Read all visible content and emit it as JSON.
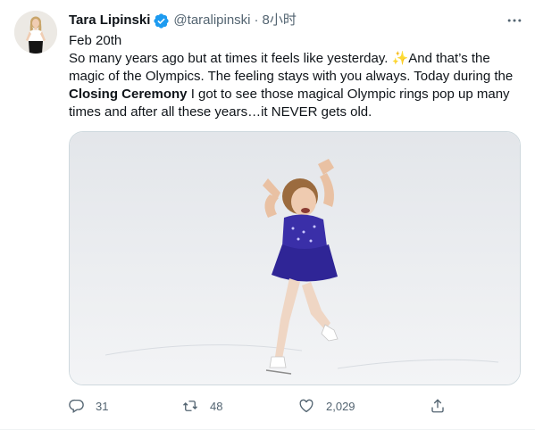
{
  "tweet": {
    "author": {
      "display_name": "Tara Lipinski",
      "handle": "@taralipinski",
      "verified_icon": "verified-badge-icon",
      "separator": "·",
      "time": "8小时"
    },
    "text": {
      "date_line": "Feb 20th",
      "segment_1": "So many years ago but at times it feels like yesterday. ",
      "sparkle": "✨",
      "segment_2": "And that’s the magic of the Olympics. The feeling stays with you always. Today during the ",
      "bold": "Closing Ceremony",
      "segment_3": " I got to see those magical Olympic rings pop up many times and after all these years…it NEVER gets old."
    },
    "actions": {
      "reply_count": "31",
      "retweet_count": "48",
      "like_count": "2,029"
    }
  },
  "colors": {
    "text": "#0f1419",
    "secondary": "#536471",
    "verified": "#1d9bf0",
    "dress": "#3a2fa8"
  }
}
